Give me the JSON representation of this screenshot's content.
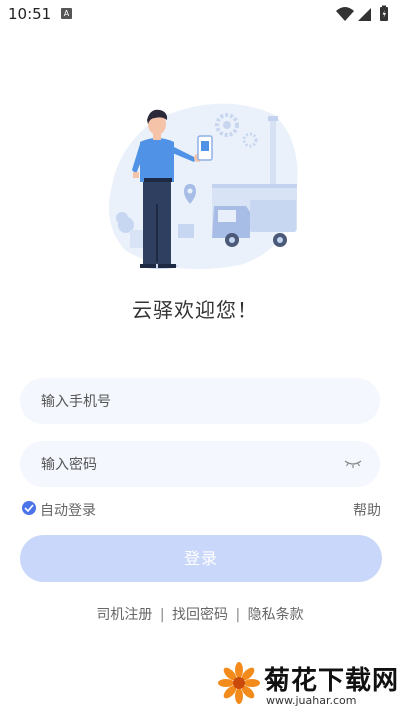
{
  "status_bar": {
    "time": "10:51",
    "notification_glyph": "A"
  },
  "welcome_text": "云驿欢迎您！",
  "form": {
    "phone_placeholder": "输入手机号",
    "password_placeholder": "输入密码",
    "remember_label": "自动登录",
    "remember_checked": true,
    "help_label": "帮助",
    "login_label": "登录"
  },
  "links": {
    "register": "司机注册",
    "separator": "|",
    "recover": "找回密码",
    "privacy": "隐私条款"
  },
  "watermark": {
    "title": "菊花下载网",
    "url": "www.juahar.com"
  },
  "colors": {
    "accent": "#4a74e8",
    "login_button_disabled": "#c9d7fa",
    "field_bg": "#f4f7fd"
  }
}
